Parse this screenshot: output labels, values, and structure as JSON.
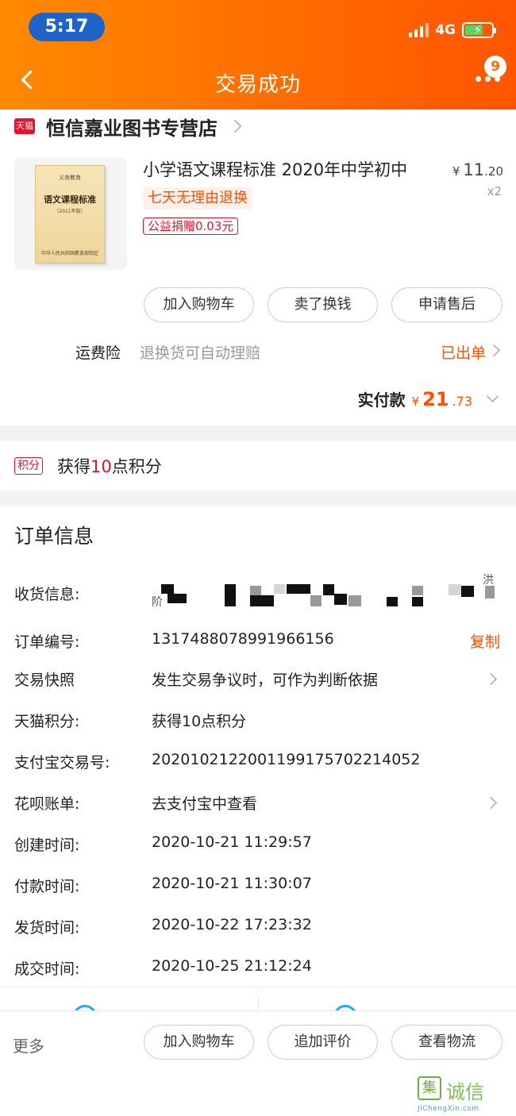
{
  "status_bar": {
    "time": "5:17",
    "network": "4G"
  },
  "header": {
    "title": "交易成功",
    "badge_count": "9"
  },
  "shop": {
    "tag": "天猫",
    "name": "恒信嘉业图书专营店"
  },
  "product": {
    "title": "小学语文课程标准 2020年中学初中",
    "price_currency": "¥",
    "price_int": "11",
    "price_dec": ".20",
    "quantity": "x2",
    "return_tag": "七天无理由退换",
    "charity_tag": "公益捐赠0.03元",
    "cover": {
      "series": "义务教育",
      "title": "语文课程标准",
      "edition": "（2011年版）",
      "publisher": "中华人民共和国教育部制定"
    }
  },
  "product_actions": [
    "加入购物车",
    "卖了换钱",
    "申请售后"
  ],
  "shipping_insurance": {
    "label": "运费险",
    "desc": "退换货可自动理赔",
    "status": "已出单"
  },
  "total": {
    "label": "实付款",
    "currency": "¥",
    "int": "21",
    "dec": ".73"
  },
  "points": {
    "tag": "积分",
    "prefix": "获得",
    "num": "10",
    "suffix": "点积分"
  },
  "order_info": {
    "title": "订单信息",
    "address_label": "收货信息:",
    "address_partial": [
      "洪",
      "阶"
    ],
    "rows": [
      {
        "label": "订单编号:",
        "value": "1317488078991966156",
        "action": "复制"
      },
      {
        "label": "交易快照",
        "value": "发生交易争议时，可作为判断依据"
      },
      {
        "label": "天猫积分:",
        "value": "获得10点积分"
      },
      {
        "label": "支付宝交易号:",
        "value": "2020102122001199175702214052"
      },
      {
        "label": "花呗账单:",
        "value": "去支付宝中查看"
      },
      {
        "label": "创建时间:",
        "value": "2020-10-21 11:29:57"
      },
      {
        "label": "付款时间:",
        "value": "2020-10-21 11:30:07"
      },
      {
        "label": "发货时间:",
        "value": "2020-10-22 17:23:32"
      },
      {
        "label": "成交时间:",
        "value": "2020-10-25 21:12:24"
      }
    ]
  },
  "bottom_bar": {
    "more": "更多",
    "buttons": [
      "加入购物车",
      "追加评价",
      "查看物流"
    ]
  },
  "watermark": {
    "logo": "集",
    "text": "诚信",
    "url": "JiChengXin.com"
  },
  "colors": {
    "header_orange": "#ff6a00",
    "accent": "#ff5000",
    "tmall_red": "#e8122a"
  }
}
